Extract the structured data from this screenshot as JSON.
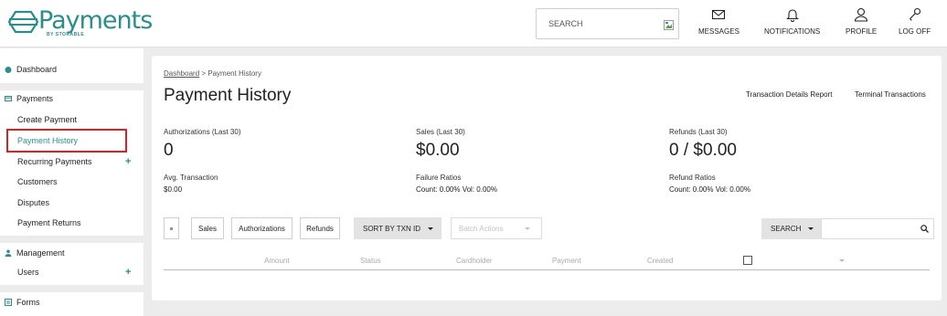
{
  "brand": {
    "name": "Payments",
    "sub": "BY STORABLE",
    "color": "#2a8e8b"
  },
  "header": {
    "search_placeholder": "SEARCH",
    "nav": [
      {
        "label": "MESSAGES",
        "icon": "envelope-icon"
      },
      {
        "label": "NOTIFICATIONS",
        "icon": "bell-icon"
      },
      {
        "label": "PROFILE",
        "icon": "user-icon"
      },
      {
        "label": "LOG OFF",
        "icon": "key-icon"
      }
    ]
  },
  "sidebar": {
    "dashboard": "Dashboard",
    "payments": {
      "label": "Payments",
      "items": [
        "Create Payment",
        "Payment History",
        "Recurring Payments",
        "Customers",
        "Disputes",
        "Payment Returns"
      ]
    },
    "management": {
      "label": "Management",
      "items": [
        "Users"
      ]
    },
    "forms": {
      "label": "Forms"
    },
    "plus": "+"
  },
  "main": {
    "breadcrumb": {
      "link": "Dashboard",
      "sep": " > ",
      "current": "Payment History"
    },
    "title": "Payment History",
    "links": [
      "Transaction Details Report",
      "Terminal Transactions"
    ],
    "stats": [
      {
        "label": "Authorizations (Last 30)",
        "value": "0"
      },
      {
        "label": "Sales (Last 30)",
        "value": "$0.00"
      },
      {
        "label": "Refunds (Last 30)",
        "value": "0 / $0.00"
      }
    ],
    "substats": [
      {
        "label": "Avg. Transaction",
        "value": "$0.00"
      },
      {
        "label": "Failure Ratios",
        "value": "Count: 0.00%  Vol: 0.00%"
      },
      {
        "label": "Refund Ratios",
        "value": "Count: 0.00%  Vol: 0.00%"
      }
    ],
    "filters": [
      "Sales",
      "Authorizations",
      "Refunds"
    ],
    "sort_label": "SORT BY  TXN ID",
    "batch_label": "Batch Actions",
    "search_label": "SEARCH",
    "columns": [
      "Amount",
      "Status",
      "Cardholder",
      "Payment",
      "Created"
    ]
  }
}
